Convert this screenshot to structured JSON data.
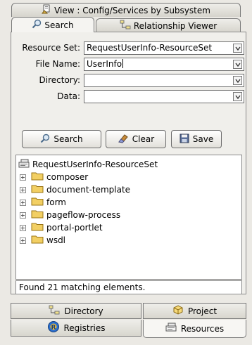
{
  "view_tab": {
    "label": "View : Config/Services by Subsystem",
    "icon": "view-icon"
  },
  "tabs": [
    {
      "label": "Search",
      "icon": "search-icon",
      "active": true
    },
    {
      "label": "Relationship Viewer",
      "icon": "relationship-icon",
      "active": false
    }
  ],
  "form": {
    "resource_set": {
      "label": "Resource Set:",
      "value": "RequestUserInfo-ResourceSet"
    },
    "file_name": {
      "label": "File Name:",
      "value": "UserInfo"
    },
    "directory": {
      "label": "Directory:",
      "value": ""
    },
    "data": {
      "label": "Data:",
      "value": ""
    }
  },
  "buttons": {
    "search": "Search",
    "clear": "Clear",
    "save": "Save"
  },
  "tree": {
    "root": "RequestUserInfo-ResourceSet",
    "children": [
      "composer",
      "document-template",
      "form",
      "pageflow-process",
      "portal-portlet",
      "wsdl"
    ]
  },
  "status": "Found 21 matching elements.",
  "bottom_tabs": [
    {
      "label": "Directory",
      "icon": "directory-icon"
    },
    {
      "label": "Project",
      "icon": "project-icon"
    },
    {
      "label": "Registries",
      "icon": "registries-icon"
    },
    {
      "label": "Resources",
      "icon": "resources-icon",
      "active": true
    }
  ],
  "colors": {
    "background": "#ebe9e4",
    "folder": "#e9c14a",
    "registries_blue": "#2a6fd0"
  }
}
